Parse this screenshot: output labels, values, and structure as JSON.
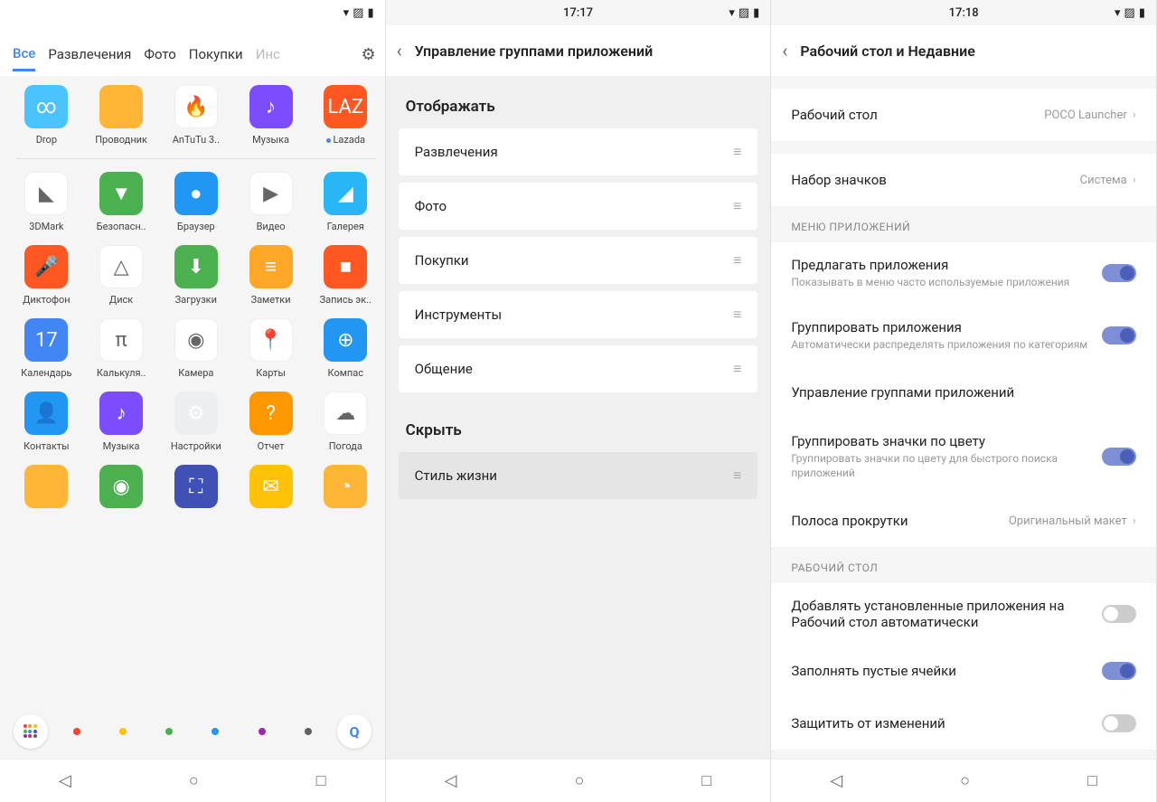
{
  "screen1": {
    "tabs": [
      "Все",
      "Развлечения",
      "Фото",
      "Покупки",
      "Инс"
    ],
    "tab_active": 0,
    "apps_row1": [
      {
        "label": "Drop",
        "bg": "#4bc3ff",
        "glyph": "∞"
      },
      {
        "label": "Проводник",
        "bg": "#ffb636",
        "glyph": ""
      },
      {
        "label": "AnTuTu 3..",
        "bg": "#fff",
        "glyph": "🔥"
      },
      {
        "label": "Музыка",
        "bg": "#7b4dff",
        "glyph": "♪"
      },
      {
        "label": "Lazada",
        "bg": "#ff5722",
        "glyph": "LAZ",
        "new": true
      }
    ],
    "apps_row2": [
      {
        "label": "3DMark",
        "bg": "#fff",
        "glyph": "◣"
      },
      {
        "label": "Безопасн..",
        "bg": "#4caf50",
        "glyph": "▼"
      },
      {
        "label": "Браузер",
        "bg": "#2196f3",
        "glyph": "●"
      },
      {
        "label": "Видео",
        "bg": "#fff",
        "glyph": "▶"
      },
      {
        "label": "Галерея",
        "bg": "#29b6f6",
        "glyph": "◢"
      }
    ],
    "apps_row3": [
      {
        "label": "Диктофон",
        "bg": "#ff5722",
        "glyph": "🎤"
      },
      {
        "label": "Диск",
        "bg": "#fff",
        "glyph": "△"
      },
      {
        "label": "Загрузки",
        "bg": "#4caf50",
        "glyph": "⬇"
      },
      {
        "label": "Заметки",
        "bg": "#ffa726",
        "glyph": "≡"
      },
      {
        "label": "Запись эк..",
        "bg": "#ff5722",
        "glyph": "■"
      }
    ],
    "apps_row4": [
      {
        "label": "Календарь",
        "bg": "#4285f4",
        "glyph": "17"
      },
      {
        "label": "Калькуля..",
        "bg": "#fff",
        "glyph": "π"
      },
      {
        "label": "Камера",
        "bg": "#fff",
        "glyph": "◉"
      },
      {
        "label": "Карты",
        "bg": "#fff",
        "glyph": "📍"
      },
      {
        "label": "Компас",
        "bg": "#2196f3",
        "glyph": "⊕"
      }
    ],
    "apps_row5": [
      {
        "label": "Контакты",
        "bg": "#2196f3",
        "glyph": "👤"
      },
      {
        "label": "Музыка",
        "bg": "#7b4dff",
        "glyph": "♪"
      },
      {
        "label": "Настройки",
        "bg": "#eceff1",
        "glyph": "⚙"
      },
      {
        "label": "Отчет",
        "bg": "#ff9800",
        "glyph": "?"
      },
      {
        "label": "Погода",
        "bg": "#fff",
        "glyph": "☁"
      }
    ],
    "apps_row6": [
      {
        "label": "",
        "bg": "#ffb636",
        "glyph": ""
      },
      {
        "label": "",
        "bg": "#4caf50",
        "glyph": "◉"
      },
      {
        "label": "",
        "bg": "#3f51b5",
        "glyph": "⛶"
      },
      {
        "label": "",
        "bg": "#ffc107",
        "glyph": "✉"
      },
      {
        "label": "",
        "bg": "#ffb636",
        "glyph": "◔"
      }
    ],
    "color_dots": [
      "#f44336",
      "#ffc107",
      "#4caf50",
      "#2196f3",
      "#9c27b0",
      "#616161"
    ]
  },
  "screen2": {
    "time": "17:17",
    "title": "Управление группами приложений",
    "section_show": "Отображать",
    "section_hide": "Скрыть",
    "show_items": [
      "Развлечения",
      "Фото",
      "Покупки",
      "Инструменты",
      "Общение"
    ],
    "hide_items": [
      "Стиль жизни"
    ]
  },
  "screen3": {
    "time": "17:18",
    "title": "Рабочий стол и Недавние",
    "item_home": "Рабочий стол",
    "item_home_val": "POCO Launcher",
    "item_iconset": "Набор значков",
    "item_iconset_val": "Система",
    "section_appmenu": "МЕНЮ ПРИЛОЖЕНИЙ",
    "item_suggest": "Предлагать приложения",
    "item_suggest_sub": "Показывать в меню часто используемые приложения",
    "item_group": "Группировать приложения",
    "item_group_sub": "Автоматически распределять приложения по категориям",
    "item_manage": "Управление группами приложений",
    "item_color": "Группировать значки по цвету",
    "item_color_sub": "Группировать значки по цвету для быстрого поиска приложений",
    "item_scroll": "Полоса прокрутки",
    "item_scroll_val": "Оригинальный макет",
    "section_home": "РАБОЧИЙ СТОЛ",
    "item_autoadd": "Добавлять установленные приложения на Рабочий стол автоматически",
    "item_fill": "Заполнять пустые ячейки",
    "item_lock": "Защитить от изменений"
  }
}
